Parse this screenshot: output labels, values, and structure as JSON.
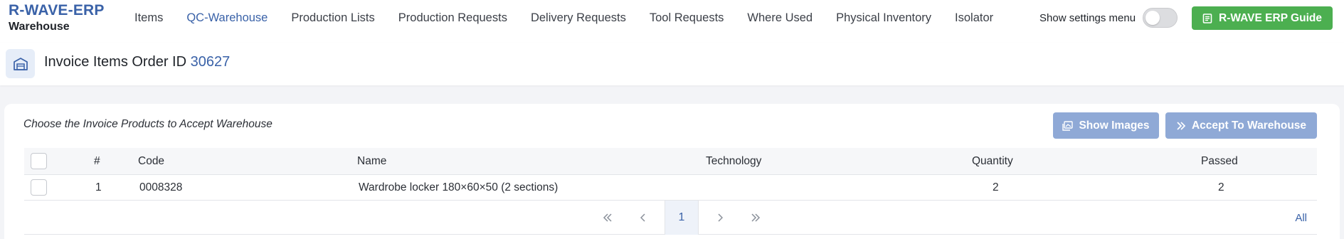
{
  "brand": {
    "name": "R-WAVE-ERP",
    "module": "Warehouse"
  },
  "nav": {
    "items": [
      {
        "label": "Items"
      },
      {
        "label": "QC-Warehouse",
        "active": true
      },
      {
        "label": "Production Lists"
      },
      {
        "label": "Production Requests"
      },
      {
        "label": "Delivery Requests"
      },
      {
        "label": "Tool Requests"
      },
      {
        "label": "Where Used"
      },
      {
        "label": "Physical Inventory"
      },
      {
        "label": "Isolator"
      }
    ]
  },
  "settings": {
    "label": "Show settings menu",
    "enabled": false
  },
  "guide_button": {
    "label": "R-WAVE ERP Guide"
  },
  "header": {
    "title": "Invoice Items Order ID",
    "order_id": "30627"
  },
  "card": {
    "subtitle": "Choose the Invoice Products to Accept Warehouse",
    "show_images_label": "Show Images",
    "accept_label": "Accept To Warehouse"
  },
  "table": {
    "columns": [
      "#",
      "Code",
      "Name",
      "Technology",
      "Quantity",
      "Passed"
    ],
    "rows": [
      {
        "num": "1",
        "code": "0008328",
        "name": "Wardrobe locker 180×60×50 (2 sections)",
        "technology": "",
        "quantity": "2",
        "passed": "2"
      }
    ]
  },
  "pagination": {
    "current_page": "1",
    "page_size_label": "All"
  },
  "colors": {
    "accent": "#3a62a8",
    "success": "#4caf50",
    "button_disabled": "#8fa9d6"
  }
}
